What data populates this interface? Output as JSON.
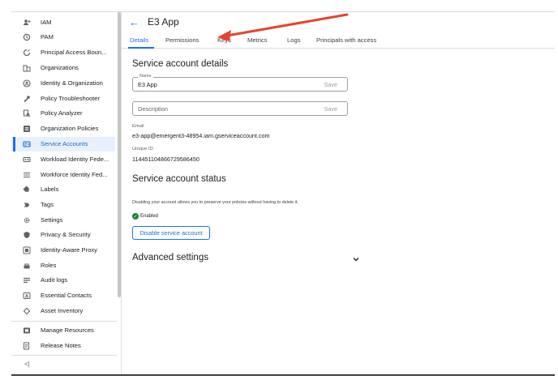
{
  "sidebar": {
    "items": [
      {
        "label": "IAM",
        "icon": "person-add-icon"
      },
      {
        "label": "PAM",
        "icon": "shield-clock-icon"
      },
      {
        "label": "Principal Access Boun...",
        "icon": "boundary-icon"
      },
      {
        "label": "Organizations",
        "icon": "building-icon"
      },
      {
        "label": "Identity & Organization",
        "icon": "account-circle-icon"
      },
      {
        "label": "Policy Troubleshooter",
        "icon": "wrench-icon"
      },
      {
        "label": "Policy Analyzer",
        "icon": "document-search-icon"
      },
      {
        "label": "Organization Policies",
        "icon": "list-box-icon"
      },
      {
        "label": "Service Accounts",
        "icon": "service-account-icon"
      },
      {
        "label": "Workload Identity Fede...",
        "icon": "id-card-icon"
      },
      {
        "label": "Workforce Identity Fed...",
        "icon": "list-icon"
      },
      {
        "label": "Labels",
        "icon": "label-icon"
      },
      {
        "label": "Tags",
        "icon": "tag-arrow-icon"
      },
      {
        "label": "Settings",
        "icon": "gear-icon"
      },
      {
        "label": "Privacy & Security",
        "icon": "shield-icon"
      },
      {
        "label": "Identity-Aware Proxy",
        "icon": "proxy-icon"
      },
      {
        "label": "Roles",
        "icon": "roles-icon"
      },
      {
        "label": "Audit logs",
        "icon": "list-lines-icon"
      },
      {
        "label": "Essential Contacts",
        "icon": "contact-card-icon"
      },
      {
        "label": "Asset Inventory",
        "icon": "diamond-icon"
      }
    ],
    "bottom_items": [
      {
        "label": "Manage Resources",
        "icon": "folder-icon"
      },
      {
        "label": "Release Notes",
        "icon": "notes-icon"
      }
    ],
    "active_label": "Service Accounts",
    "collapse_glyph": "<|"
  },
  "header": {
    "title": "E3 App",
    "back_glyph": "←"
  },
  "tabs": [
    {
      "label": "Details"
    },
    {
      "label": "Permissions"
    },
    {
      "label": "Keys"
    },
    {
      "label": "Metrics"
    },
    {
      "label": "Logs"
    },
    {
      "label": "Principals with access"
    }
  ],
  "details": {
    "section_title": "Service account details",
    "name_label": "Name",
    "name_value": "E3 App",
    "name_save": "Save",
    "description_placeholder": "Description",
    "description_save": "Save",
    "email_label": "Email",
    "email_value": "e3-app@emergent3-48954.iam.gserviceaccount.com",
    "unique_id_label": "Unique ID",
    "unique_id_value": "114451104866729586450"
  },
  "status_section": {
    "title": "Service account status",
    "note": "Disabling your account allows you to preserve your policies without having to delete it.",
    "status_text": "Enabled",
    "disable_button": "Disable service account"
  },
  "advanced": {
    "title": "Advanced settings"
  },
  "colors": {
    "accent": "#1a73e8",
    "active_bg": "#e8f0fe",
    "enabled": "#188038",
    "annotation_arrow": "#e8432d"
  }
}
